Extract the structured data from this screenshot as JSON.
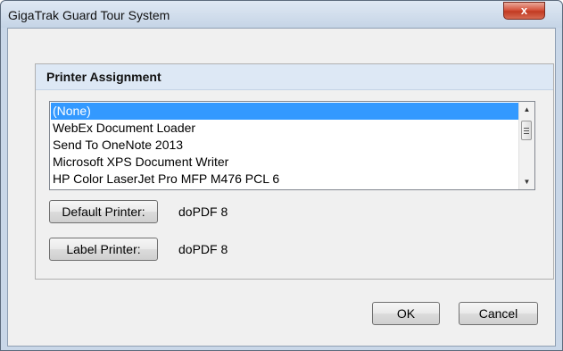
{
  "window": {
    "title": "GigaTrak Guard Tour System",
    "close_label": "x"
  },
  "printer_assignment": {
    "title": "Printer Assignment",
    "printers": [
      {
        "label": "(None)",
        "selected": true
      },
      {
        "label": "WebEx Document Loader",
        "selected": false
      },
      {
        "label": "Send To OneNote 2013",
        "selected": false
      },
      {
        "label": "Microsoft XPS Document Writer",
        "selected": false
      },
      {
        "label": "HP Color LaserJet Pro MFP M476 PCL 6",
        "selected": false
      }
    ],
    "default_printer": {
      "button_label": "Default Printer:",
      "value": "doPDF 8"
    },
    "label_printer": {
      "button_label": "Label Printer:",
      "value": "doPDF 8"
    }
  },
  "buttons": {
    "ok": "OK",
    "cancel": "Cancel"
  },
  "colors": {
    "selection": "#3399ff",
    "header": "#dde8f5",
    "close": "#c23a22"
  }
}
